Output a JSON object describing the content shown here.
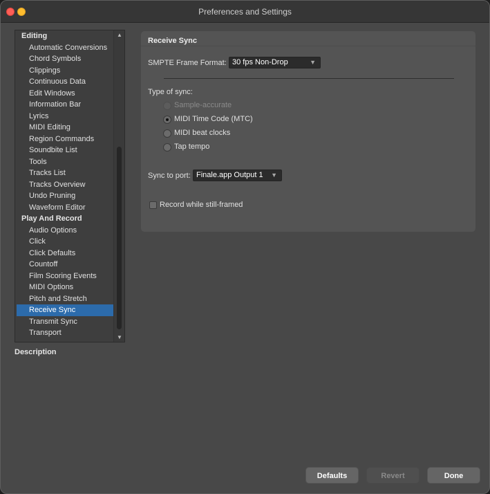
{
  "window": {
    "title": "Preferences and Settings"
  },
  "sidebar": {
    "items": [
      {
        "label": "Editing",
        "type": "category"
      },
      {
        "label": "Automatic Conversions",
        "type": "item"
      },
      {
        "label": "Chord Symbols",
        "type": "item"
      },
      {
        "label": "Clippings",
        "type": "item"
      },
      {
        "label": "Continuous Data",
        "type": "item"
      },
      {
        "label": "Edit Windows",
        "type": "item"
      },
      {
        "label": "Information Bar",
        "type": "item"
      },
      {
        "label": "Lyrics",
        "type": "item"
      },
      {
        "label": "MIDI Editing",
        "type": "item"
      },
      {
        "label": "Region Commands",
        "type": "item"
      },
      {
        "label": "Soundbite List",
        "type": "item"
      },
      {
        "label": "Tools",
        "type": "item"
      },
      {
        "label": "Tracks List",
        "type": "item"
      },
      {
        "label": "Tracks Overview",
        "type": "item"
      },
      {
        "label": "Undo Pruning",
        "type": "item"
      },
      {
        "label": "Waveform Editor",
        "type": "item"
      },
      {
        "label": "Play And Record",
        "type": "category"
      },
      {
        "label": "Audio Options",
        "type": "item"
      },
      {
        "label": "Click",
        "type": "item"
      },
      {
        "label": "Click Defaults",
        "type": "item"
      },
      {
        "label": "Countoff",
        "type": "item"
      },
      {
        "label": "Film Scoring Events",
        "type": "item"
      },
      {
        "label": "MIDI Options",
        "type": "item"
      },
      {
        "label": "Pitch and Stretch",
        "type": "item"
      },
      {
        "label": "Receive Sync",
        "type": "item",
        "selected": true
      },
      {
        "label": "Transmit Sync",
        "type": "item"
      },
      {
        "label": "Transport",
        "type": "item"
      }
    ],
    "selected_color": "#2c6bab"
  },
  "description": {
    "label": "Description"
  },
  "panel": {
    "title": "Receive Sync",
    "smpte": {
      "label": "SMPTE Frame Format:",
      "value": "30 fps Non-Drop"
    },
    "sync_type": {
      "label": "Type of sync:",
      "options": [
        {
          "label": "Sample-accurate",
          "selected": false,
          "disabled": true
        },
        {
          "label": "MIDI Time Code (MTC)",
          "selected": true,
          "disabled": false
        },
        {
          "label": "MIDI beat clocks",
          "selected": false,
          "disabled": false
        },
        {
          "label": "Tap tempo",
          "selected": false,
          "disabled": false
        }
      ]
    },
    "port": {
      "label": "Sync to port:",
      "value": "Finale.app Output 1"
    },
    "record_still": {
      "label": "Record while still-framed",
      "checked": false
    }
  },
  "buttons": {
    "defaults": "Defaults",
    "revert": "Revert",
    "done": "Done"
  }
}
